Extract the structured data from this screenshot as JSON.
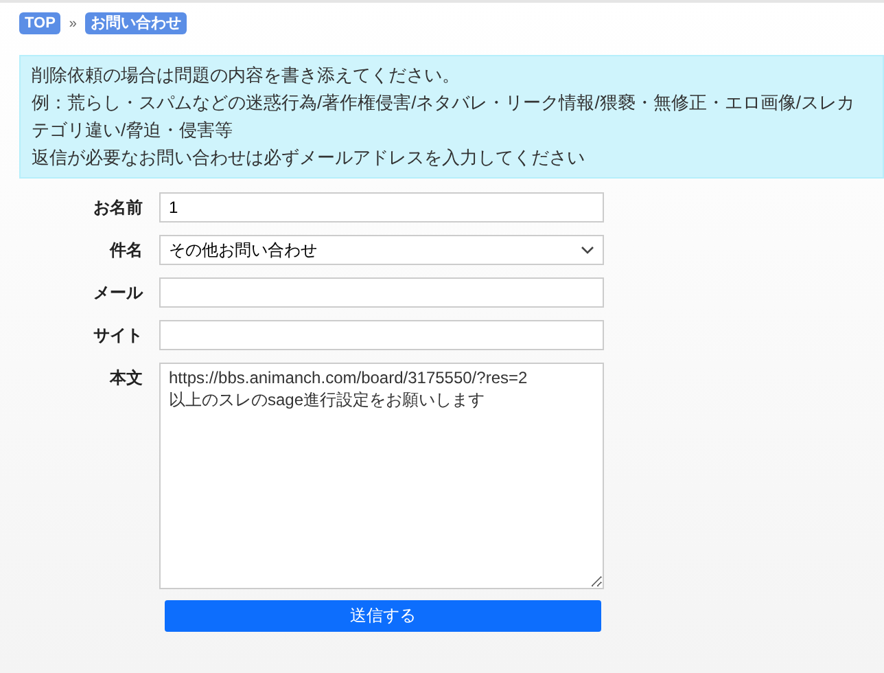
{
  "breadcrumbs": [
    {
      "label": "TOP"
    },
    {
      "label": "お問い合わせ"
    }
  ],
  "breadcrumb_separator": "»",
  "notice": [
    "削除依頼の場合は問題の内容を書き添えてください。",
    "例：荒らし・スパムなどの迷惑行為/著作権侵害/ネタバレ・リーク情報/猥褻・無修正・エロ画像/スレカテゴリ違い/脅迫・侵害等",
    "返信が必要なお問い合わせは必ずメールアドレスを入力してください"
  ],
  "form": [
    {
      "kind": "text",
      "label": "お名前",
      "value": "1"
    },
    {
      "kind": "select",
      "label": "件名",
      "value": "その他お問い合わせ"
    },
    {
      "kind": "text",
      "label": "メール"
    },
    {
      "kind": "text",
      "label": "サイト"
    },
    {
      "kind": "textarea",
      "label": "本文",
      "value": "https://bbs.animanch.com/board/3175550/?res=2\n以上のスレのsage進行設定をお願いします"
    }
  ],
  "submit": "送信する"
}
